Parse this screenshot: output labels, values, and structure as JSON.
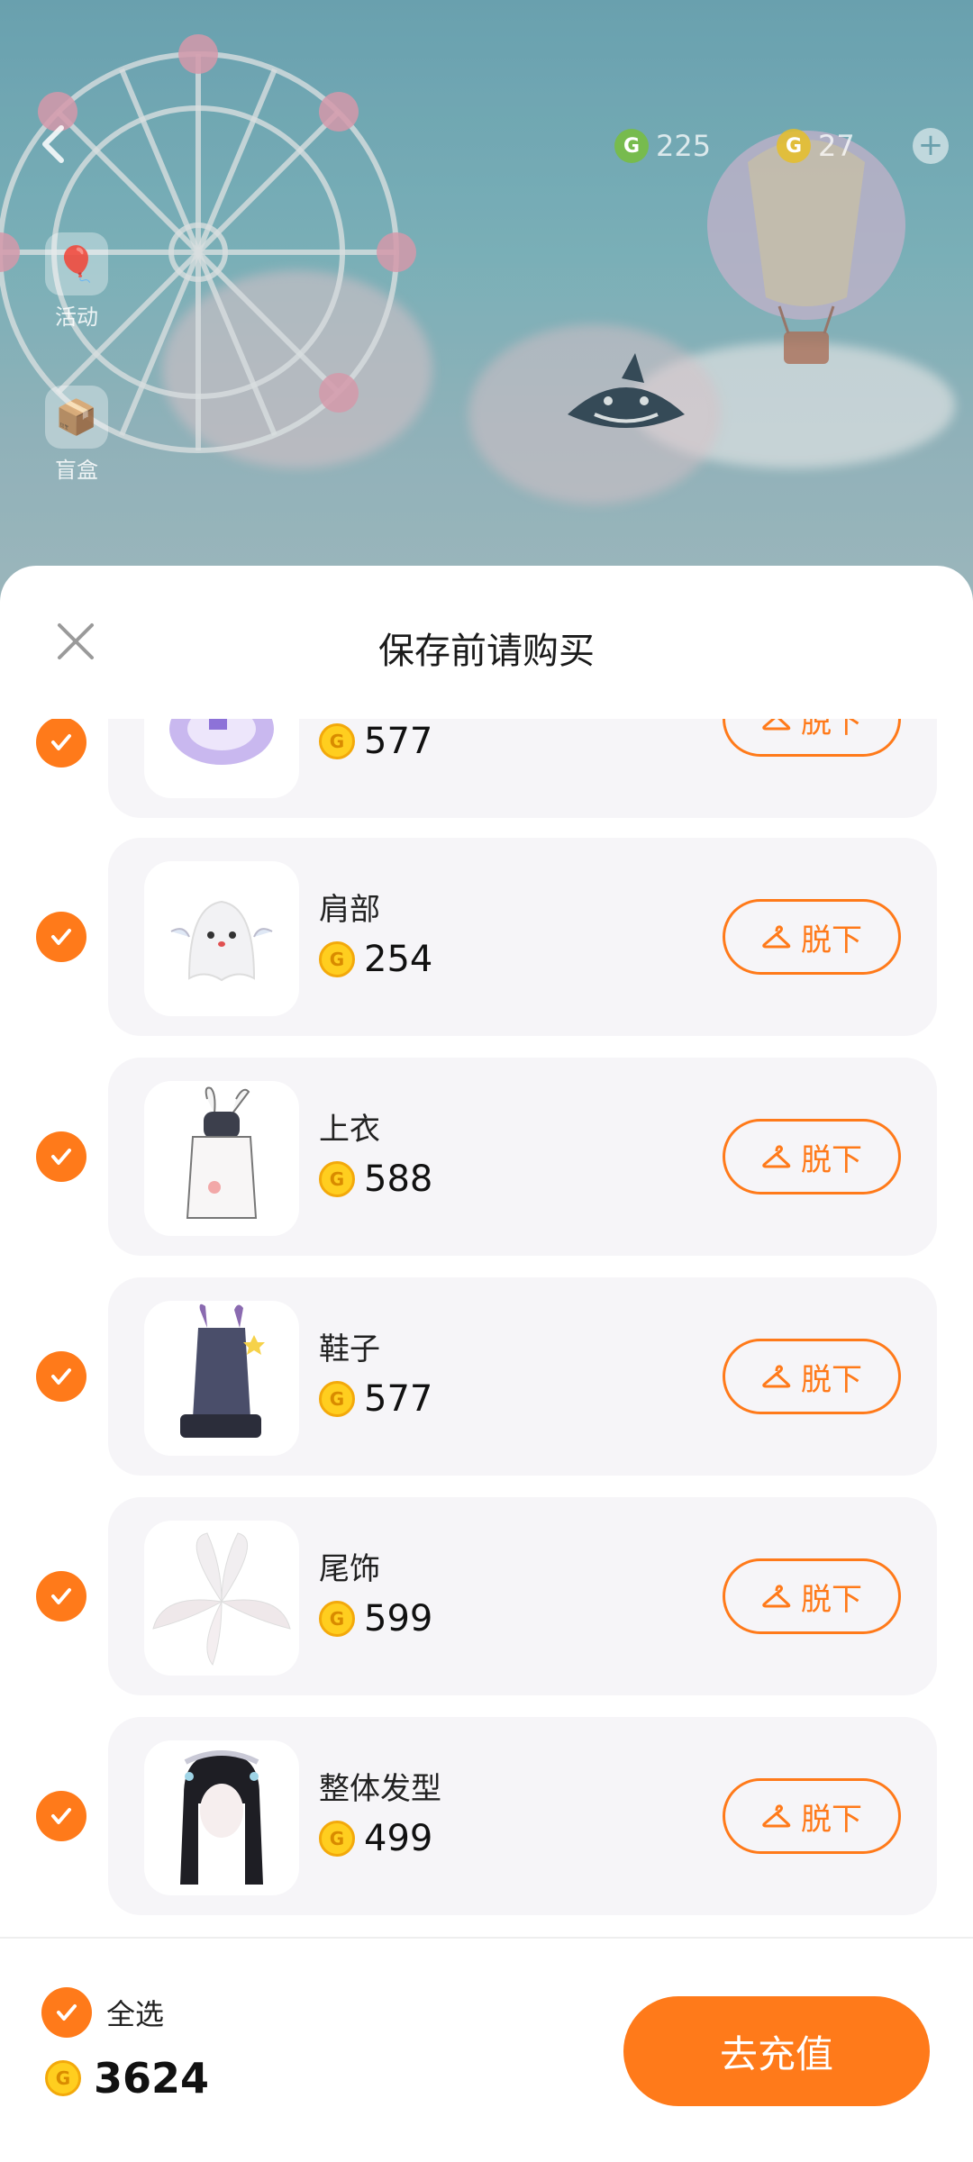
{
  "top_bar": {
    "currency_1": {
      "icon": "g-coin-green-icon",
      "value": "225"
    },
    "currency_2": {
      "icon": "g-coin-gold-icon",
      "value": "27"
    }
  },
  "side_menu": [
    {
      "label": "活动",
      "icon": "hot-air-balloon-icon"
    },
    {
      "label": "盲盒",
      "icon": "mystery-box-icon"
    }
  ],
  "sheet": {
    "title": "保存前请购买"
  },
  "items": [
    {
      "name": "",
      "price": "577",
      "remove_label": "脱下",
      "thumb": "purple-magic-circle"
    },
    {
      "name": "肩部",
      "price": "254",
      "remove_label": "脱下",
      "thumb": "ghost-cat"
    },
    {
      "name": "上衣",
      "price": "588",
      "remove_label": "脱下",
      "thumb": "bunny-hoodie"
    },
    {
      "name": "鞋子",
      "price": "577",
      "remove_label": "脱下",
      "thumb": "bunny-boots"
    },
    {
      "name": "尾饰",
      "price": "599",
      "remove_label": "脱下",
      "thumb": "white-fox-tails"
    },
    {
      "name": "整体发型",
      "price": "499",
      "remove_label": "脱下",
      "thumb": "black-hair-maid"
    }
  ],
  "footer": {
    "select_all_label": "全选",
    "total": "3624",
    "recharge_label": "去充值"
  },
  "colors": {
    "accent": "#ff7a1a",
    "card_bg": "#f6f5f8",
    "coin": "#ffce1f"
  }
}
